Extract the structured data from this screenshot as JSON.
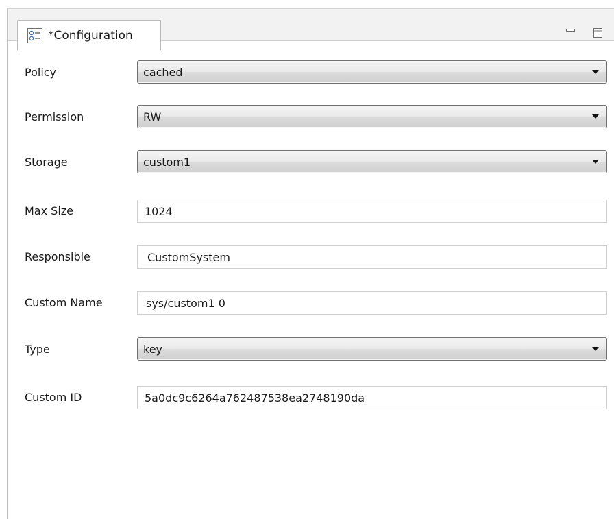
{
  "tab": {
    "title": "*Configuration",
    "icon": "form-icon"
  },
  "window_controls": {
    "minimize_icon": "minimize-icon",
    "maximize_icon": "maximize-icon"
  },
  "fields": {
    "policy": {
      "label": "Policy",
      "value": "cached"
    },
    "permission": {
      "label": "Permission",
      "value": "RW"
    },
    "storage": {
      "label": "Storage",
      "value": "custom1"
    },
    "max_size": {
      "label": "Max Size",
      "value": "1024"
    },
    "responsible": {
      "label": "Responsible",
      "value": "CustomSystem"
    },
    "custom_name": {
      "label": "Custom Name",
      "value": "sys/custom1 0"
    },
    "type": {
      "label": "Type",
      "value": "key"
    },
    "custom_id": {
      "label": "Custom ID",
      "value": "5a0dc9c6264a762487538ea2748190da"
    }
  },
  "colors": {
    "tab_strip": "#f2f2f2",
    "combo_border": "#707070",
    "field_border": "#d0d0d0"
  }
}
